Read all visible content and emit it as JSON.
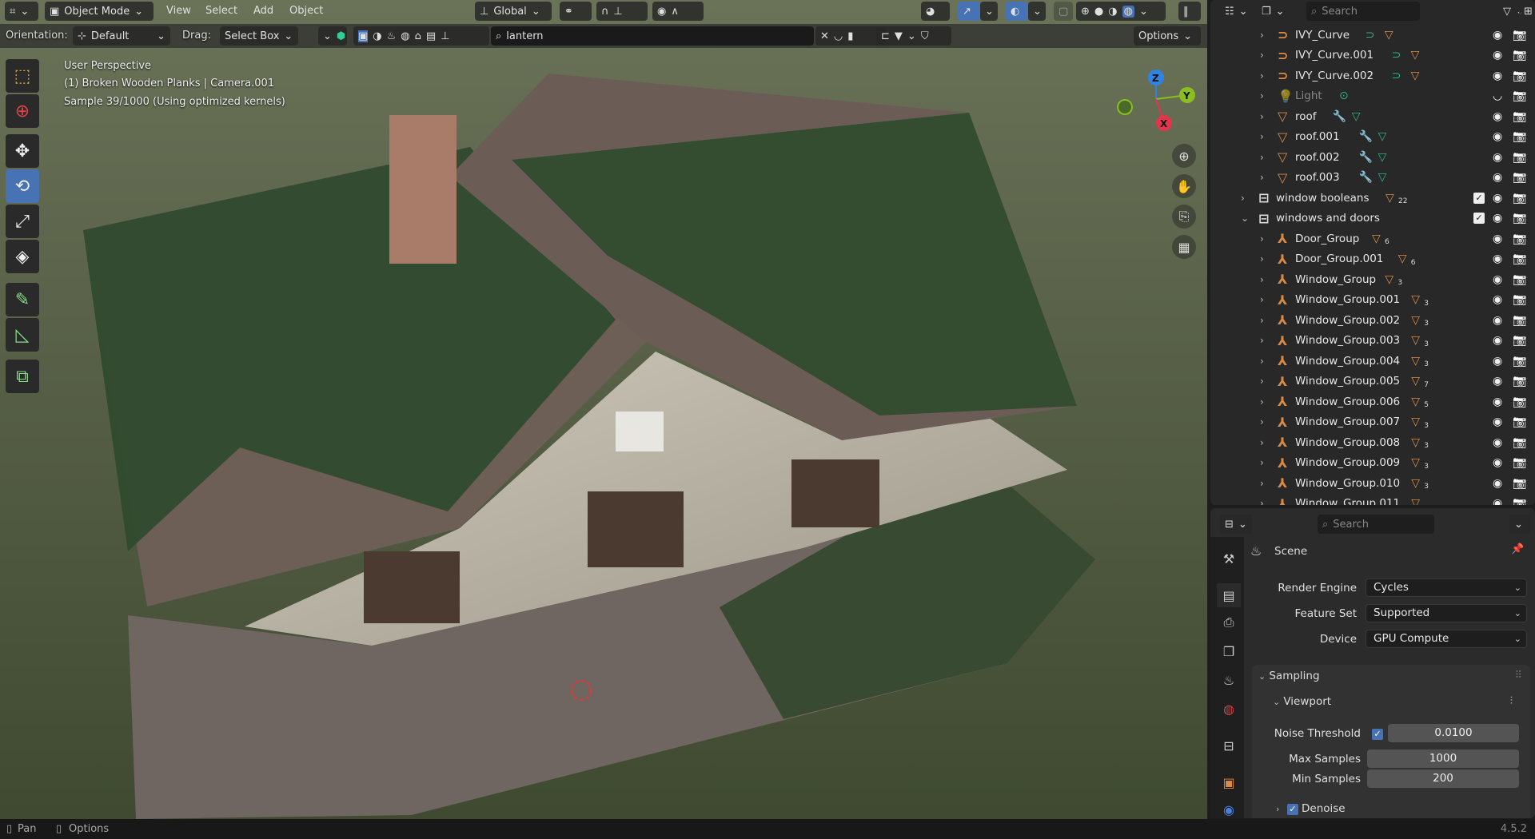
{
  "header": {
    "editor_type_icon": "viewport-icon",
    "mode": "Object Mode",
    "menus": [
      "View",
      "Select",
      "Add",
      "Object"
    ],
    "transform_orientation": "Global",
    "orientation_label": "Orientation:",
    "orientation_value": "Default",
    "drag_label": "Drag:",
    "drag_value": "Select Box",
    "search_value": "lantern",
    "options_label": "Options"
  },
  "viewport": {
    "overlay_lines": [
      "User Perspective",
      "(1) Broken Wooden Planks | Camera.001",
      "Sample 39/1000 (Using optimized kernels)"
    ],
    "gizmo_axes": {
      "z": "Z",
      "y": "Y",
      "x": "X"
    },
    "axis_colors": {
      "x": "#e2344a",
      "y": "#8bbe1f",
      "z": "#2f84e3"
    },
    "tools": [
      "select-box",
      "cursor",
      "move",
      "rotate",
      "scale",
      "transform",
      "annotate",
      "measure",
      "add-cube"
    ],
    "active_tool": "rotate"
  },
  "outliner": {
    "search_placeholder": "Search",
    "rows": [
      {
        "name": "IVY_Curve",
        "level": 2,
        "icon": "curve",
        "mods": [
          "curve-data",
          "mesh-tri"
        ],
        "badge": ""
      },
      {
        "name": "IVY_Curve.001",
        "level": 2,
        "icon": "curve",
        "mods": [
          "curve-data",
          "mesh-tri"
        ],
        "badge": ""
      },
      {
        "name": "IVY_Curve.002",
        "level": 2,
        "icon": "curve",
        "mods": [
          "curve-data",
          "mesh-tri"
        ],
        "badge": ""
      },
      {
        "name": "Light",
        "level": 2,
        "icon": "light",
        "mods": [
          "light-data"
        ],
        "badge": "",
        "hidden": true
      },
      {
        "name": "roof",
        "level": 2,
        "icon": "mesh",
        "mods": [
          "wrench",
          "mesh-data"
        ],
        "badge": ""
      },
      {
        "name": "roof.001",
        "level": 2,
        "icon": "mesh",
        "mods": [
          "wrench",
          "mesh-data"
        ],
        "badge": ""
      },
      {
        "name": "roof.002",
        "level": 2,
        "icon": "mesh",
        "mods": [
          "wrench",
          "mesh-data"
        ],
        "badge": ""
      },
      {
        "name": "roof.003",
        "level": 2,
        "icon": "mesh",
        "mods": [
          "wrench",
          "mesh-data"
        ],
        "badge": ""
      },
      {
        "name": "window booleans",
        "level": 1,
        "icon": "collection",
        "mods": [
          "mesh-tri"
        ],
        "badge": "22",
        "checkbox": true
      },
      {
        "name": "windows and doors",
        "level": 1,
        "icon": "collection",
        "mods": [],
        "badge": "",
        "checkbox": true,
        "expanded": true
      },
      {
        "name": "Door_Group",
        "level": 2,
        "icon": "empty",
        "mods": [
          "mesh-tri"
        ],
        "badge": "6"
      },
      {
        "name": "Door_Group.001",
        "level": 2,
        "icon": "empty",
        "mods": [
          "mesh-tri"
        ],
        "badge": "6"
      },
      {
        "name": "Window_Group",
        "level": 2,
        "icon": "empty",
        "mods": [
          "mesh-tri"
        ],
        "badge": "3"
      },
      {
        "name": "Window_Group.001",
        "level": 2,
        "icon": "empty",
        "mods": [
          "mesh-tri"
        ],
        "badge": "3"
      },
      {
        "name": "Window_Group.002",
        "level": 2,
        "icon": "empty",
        "mods": [
          "mesh-tri"
        ],
        "badge": "3"
      },
      {
        "name": "Window_Group.003",
        "level": 2,
        "icon": "empty",
        "mods": [
          "mesh-tri"
        ],
        "badge": "3"
      },
      {
        "name": "Window_Group.004",
        "level": 2,
        "icon": "empty",
        "mods": [
          "mesh-tri"
        ],
        "badge": "3"
      },
      {
        "name": "Window_Group.005",
        "level": 2,
        "icon": "empty",
        "mods": [
          "mesh-tri"
        ],
        "badge": "7"
      },
      {
        "name": "Window_Group.006",
        "level": 2,
        "icon": "empty",
        "mods": [
          "mesh-tri"
        ],
        "badge": "5"
      },
      {
        "name": "Window_Group.007",
        "level": 2,
        "icon": "empty",
        "mods": [
          "mesh-tri"
        ],
        "badge": "3"
      },
      {
        "name": "Window_Group.008",
        "level": 2,
        "icon": "empty",
        "mods": [
          "mesh-tri"
        ],
        "badge": "3"
      },
      {
        "name": "Window_Group.009",
        "level": 2,
        "icon": "empty",
        "mods": [
          "mesh-tri"
        ],
        "badge": "3"
      },
      {
        "name": "Window_Group.010",
        "level": 2,
        "icon": "empty",
        "mods": [
          "mesh-tri"
        ],
        "badge": "3"
      },
      {
        "name": "Window_Group.011",
        "level": 2,
        "icon": "empty",
        "mods": [
          "mesh-tri"
        ],
        "badge": ""
      }
    ]
  },
  "properties": {
    "search_placeholder": "Search",
    "context": "Scene",
    "render_engine_label": "Render Engine",
    "render_engine": "Cycles",
    "feature_set_label": "Feature Set",
    "feature_set": "Supported",
    "device_label": "Device",
    "device": "GPU Compute",
    "sampling_label": "Sampling",
    "viewport_label": "Viewport",
    "noise_threshold_label": "Noise Threshold",
    "noise_threshold_enabled": true,
    "noise_threshold": "0.0100",
    "max_samples_label": "Max Samples",
    "max_samples": "1000",
    "min_samples_label": "Min Samples",
    "min_samples": "200",
    "denoise_label": "Denoise",
    "denoise_enabled": true
  },
  "status": {
    "pan": "Pan",
    "options": "Options",
    "version": "4.5.2"
  }
}
